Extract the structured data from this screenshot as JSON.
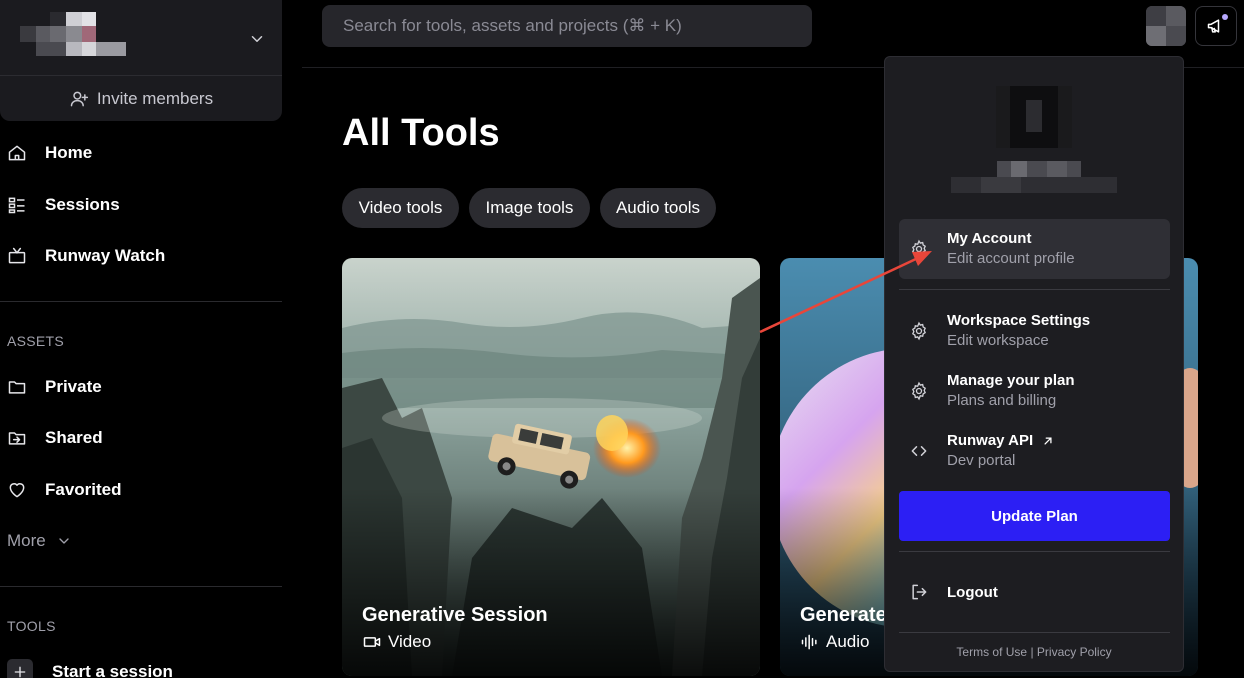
{
  "sidebar": {
    "invite_label": "Invite members",
    "nav": [
      {
        "label": "Home",
        "icon": "home-icon"
      },
      {
        "label": "Sessions",
        "icon": "sessions-icon"
      },
      {
        "label": "Runway Watch",
        "icon": "tv-icon"
      }
    ],
    "assets_header": "ASSETS",
    "assets": [
      {
        "label": "Private",
        "icon": "folder-icon"
      },
      {
        "label": "Shared",
        "icon": "shared-folder-icon"
      },
      {
        "label": "Favorited",
        "icon": "heart-icon"
      }
    ],
    "more_label": "More",
    "tools_header": "TOOLS",
    "start_session_label": "Start a session"
  },
  "search": {
    "placeholder": "Search for tools, assets and projects (⌘ + K)"
  },
  "main": {
    "title": "All Tools",
    "filters": [
      "Video tools",
      "Image tools",
      "Audio tools"
    ],
    "cards": [
      {
        "title": "Generative Session",
        "kind": "Video",
        "kind_icon": "video-camera-icon"
      },
      {
        "title": "Generate",
        "kind": "Audio",
        "kind_icon": "audio-wave-icon"
      }
    ]
  },
  "account_menu": {
    "items": [
      {
        "title": "My Account",
        "subtitle": "Edit account profile",
        "icon": "gear-icon"
      },
      {
        "title": "Workspace Settings",
        "subtitle": "Edit workspace",
        "icon": "gear-icon"
      },
      {
        "title": "Manage your plan",
        "subtitle": "Plans and billing",
        "icon": "gear-icon"
      },
      {
        "title": "Runway API",
        "subtitle": "Dev portal",
        "icon": "code-icon"
      }
    ],
    "update_plan_label": "Update Plan",
    "logout_label": "Logout",
    "terms_label": "Terms of Use",
    "separator": "|",
    "privacy_label": "Privacy Policy"
  },
  "colors": {
    "accent": "#2c1ff4",
    "annotation_arrow": "#e8463a"
  }
}
